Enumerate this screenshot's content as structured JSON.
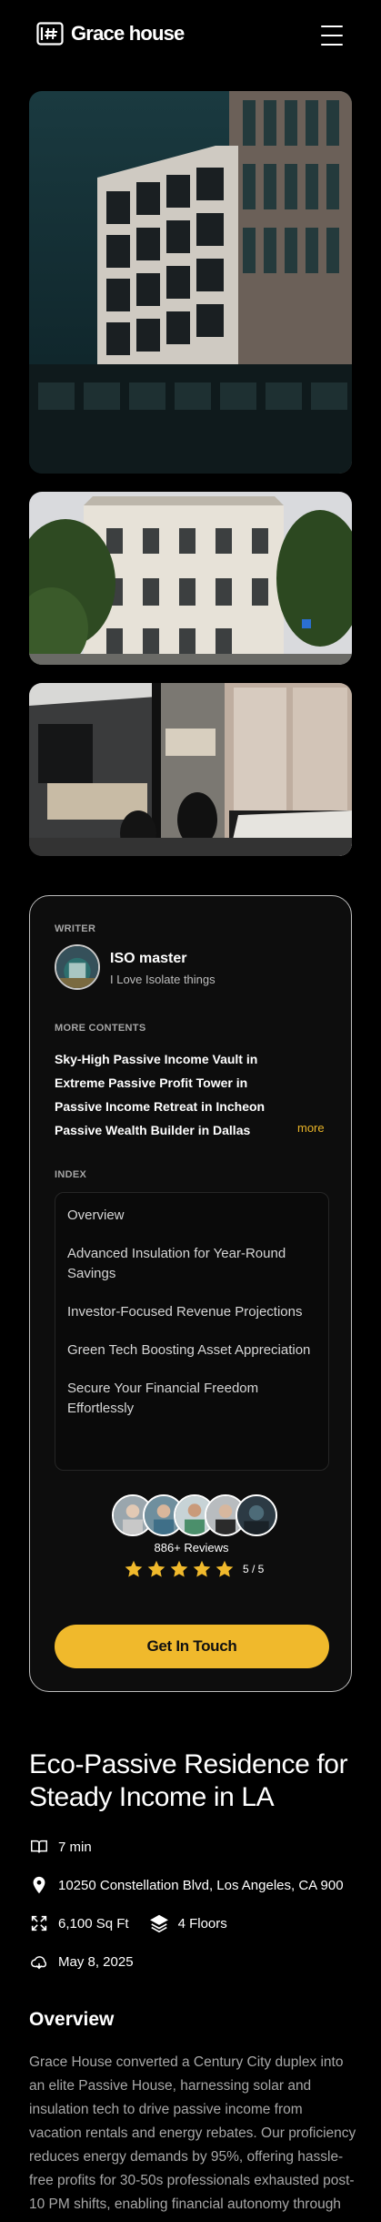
{
  "brand": {
    "name": "Grace house",
    "logo_icon": "grid-tag-icon"
  },
  "header": {
    "menu_icon": "hamburger-menu-icon"
  },
  "gallery": [
    {
      "alt": "Modern dark building facade with grid windows"
    },
    {
      "alt": "Classic white building with trees"
    },
    {
      "alt": "Office interior with desks and chairs"
    }
  ],
  "card": {
    "writer_label": "WRITER",
    "writer_name": "ISO master",
    "writer_tagline": "I Love Isolate things",
    "more_label": "MORE CONTENTS",
    "more_items": [
      "Sky-High Passive Income Vault in",
      "Extreme Passive Profit Tower in",
      "Passive Income Retreat in Incheon",
      "Passive Wealth Builder in Dallas"
    ],
    "more_link": "more",
    "index_label": "INDEX",
    "index_items": [
      "Overview",
      "Advanced Insulation for Year-Round Savings",
      "Investor-Focused Revenue Projections",
      "Green Tech Boosting Asset Appreciation",
      "Secure Your Financial Freedom Effortlessly"
    ],
    "reviews_text": "886+ Reviews",
    "rating_text": "5 / 5",
    "stars": 5,
    "cta_label": "Get In Touch"
  },
  "article": {
    "title": "Eco-Passive Residence for Steady Income in LA",
    "read_time": "7 min",
    "address": "10250 Constellation Blvd, Los Angeles, CA 900",
    "area": "6,100 Sq Ft",
    "floors": "4 Floors",
    "date": "May 8, 2025",
    "section_title": "Overview",
    "body": "Grace House converted a Century City duplex into an elite Passive House, harnessing solar and insulation tech to drive passive income from vacation rentals and energy rebates. Our proficiency reduces energy demands by 95%, offering hassle-free profits for 30-50s professionals exhausted post-10 PM shifts, enabling financial autonomy through smart,"
  },
  "colors": {
    "accent": "#f0b92c",
    "background": "#000000",
    "card_border": "#bdbdbd"
  }
}
